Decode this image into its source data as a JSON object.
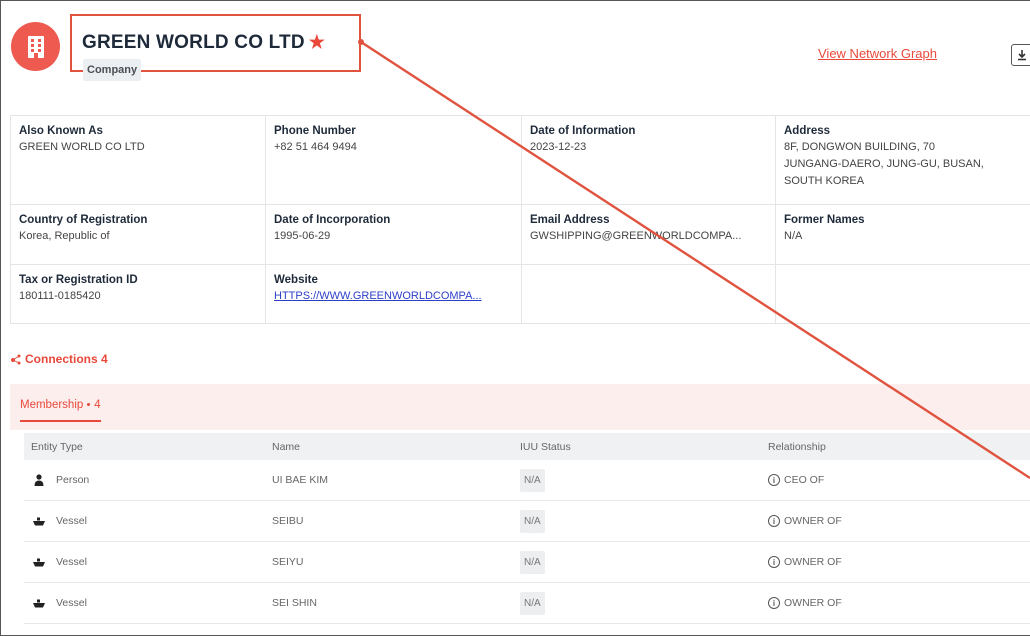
{
  "header": {
    "title": "GREEN WORLD CO LTD",
    "star": "★",
    "type_chip": "Company",
    "network_link": "View Network Graph"
  },
  "details": {
    "also_known_as": {
      "label": "Also Known As",
      "value": "GREEN WORLD CO LTD"
    },
    "phone_number": {
      "label": "Phone Number",
      "value": "+82 51 464 9494"
    },
    "date_of_information": {
      "label": "Date of Information",
      "value": "2023-12-23"
    },
    "address": {
      "label": "Address",
      "lines": [
        "8F, DONGWON BUILDING, 70",
        "JUNGANG-DAERO, JUNG-GU, BUSAN,",
        "SOUTH KOREA"
      ]
    },
    "country_of_registration": {
      "label": "Country of Registration",
      "value": "Korea, Republic of"
    },
    "date_of_incorporation": {
      "label": "Date of Incorporation",
      "value": "1995-06-29"
    },
    "email_address": {
      "label": "Email Address",
      "value": "GWSHIPPING@GREENWORLDCOMPA..."
    },
    "former_names": {
      "label": "Former Names",
      "value": "N/A"
    },
    "tax_id": {
      "label": "Tax or Registration ID",
      "value": "180111-0185420"
    },
    "website": {
      "label": "Website",
      "value": "HTTPS://WWW.GREENWORLDCOMPA..."
    }
  },
  "connections": {
    "label": "Connections 4",
    "tab_label": "Membership",
    "tab_count": "4"
  },
  "table": {
    "headers": [
      "Entity Type",
      "Name",
      "IUU Status",
      "Relationship"
    ],
    "rows": [
      {
        "entity_type": "Person",
        "icon": "person-icon",
        "name": "UI BAE KIM",
        "iuu_status": "N/A",
        "relationship": "CEO OF"
      },
      {
        "entity_type": "Vessel",
        "icon": "vessel-icon",
        "name": "SEIBU",
        "iuu_status": "N/A",
        "relationship": "OWNER OF"
      },
      {
        "entity_type": "Vessel",
        "icon": "vessel-icon",
        "name": "SEIYU",
        "iuu_status": "N/A",
        "relationship": "OWNER OF"
      },
      {
        "entity_type": "Vessel",
        "icon": "vessel-icon",
        "name": "SEI SHIN",
        "iuu_status": "N/A",
        "relationship": "OWNER OF"
      }
    ]
  },
  "colors": {
    "accent": "#e8493b",
    "annotation": "#e0543f",
    "link_blue": "#2d3fc7"
  }
}
